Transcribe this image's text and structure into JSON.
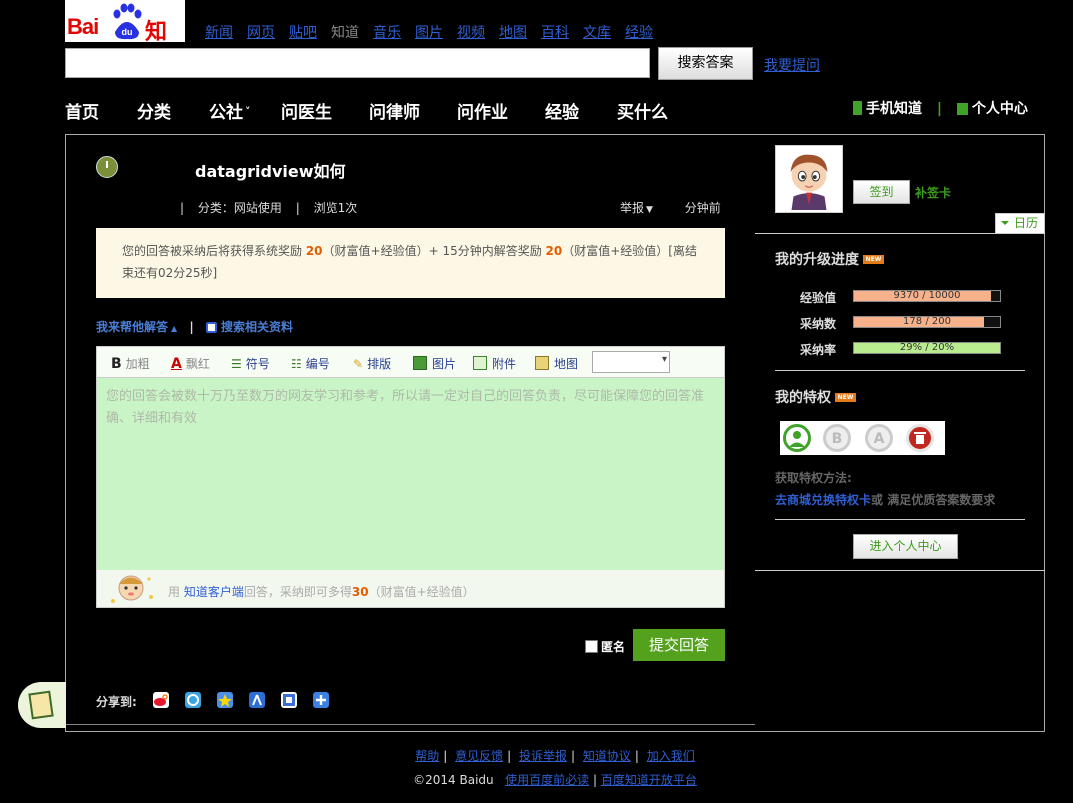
{
  "logo": {
    "text_left": "Bai",
    "text_paw": "du",
    "text_right": "知道"
  },
  "product_nav": [
    {
      "label": "新闻",
      "current": false
    },
    {
      "label": "网页",
      "current": false
    },
    {
      "label": "贴吧",
      "current": false
    },
    {
      "label": "知道",
      "current": true
    },
    {
      "label": "音乐",
      "current": false
    },
    {
      "label": "图片",
      "current": false
    },
    {
      "label": "视频",
      "current": false
    },
    {
      "label": "地图",
      "current": false
    },
    {
      "label": "百科",
      "current": false
    },
    {
      "label": "文库",
      "current": false
    },
    {
      "label": "经验",
      "current": false
    }
  ],
  "search": {
    "value": "",
    "button_label": "搜索答案",
    "ask_link": "我要提问"
  },
  "main_nav": [
    "首页",
    "分类",
    "公社",
    "问医生",
    "问律师",
    "问作业",
    "经验",
    "买什么"
  ],
  "main_nav_dropdown_icon": "chevron-down-icon",
  "right_nav": {
    "mobile": "手机知道",
    "personal": "个人中心",
    "sep": "|"
  },
  "question": {
    "title": "datagridview如何",
    "sep": "|",
    "category": "分类：网站使用",
    "views": "浏览1次",
    "report": "举报",
    "time": "分钟前"
  },
  "reward": {
    "t1": "您的回答被采纳后将获得系统奖励 ",
    "n1": "20",
    "t2": "（财富值+经验值）+ 15分钟内解答奖励 ",
    "n2": "20",
    "t3": "（财富值+经验值）[离结束还有02分25秒]"
  },
  "help": {
    "answer": "我来帮他解答",
    "sep": "|",
    "search_related": "搜索相关资料"
  },
  "toolbar": {
    "bold": "加粗",
    "red": "飘红",
    "symbol": "符号",
    "numbering": "编号",
    "format": "排版",
    "image": "图片",
    "attachment": "附件",
    "map": "地图",
    "select_value": ""
  },
  "editor": {
    "placeholder": "您的回答会被数十万乃至数万的网友学习和参考，所以请一定对自己的回答负责，尽可能保障您的回答准确、详细和有效",
    "client_prefix": "用",
    "client_link": "知道客户端",
    "client_mid": "回答，采纳即可多得",
    "client_num": "30",
    "client_suffix": "（财富值+经验值）"
  },
  "submit": {
    "anonymous": "匿名",
    "label": "提交回答"
  },
  "share": {
    "label": "分享到:"
  },
  "sidebar": {
    "sign_button": "签到",
    "make_up_card": "补签卡",
    "calendar": "日历",
    "progress_title": "我的升级进度",
    "new_tag": "NEW",
    "progress": [
      {
        "label": "经验值",
        "text": "9370 / 10000",
        "fraction": 0.937,
        "color": "#f7b28c"
      },
      {
        "label": "采纳数",
        "text": "178 / 200",
        "fraction": 0.89,
        "color": "#f7b28c"
      },
      {
        "label": "采纳率",
        "text": "29% / 20%",
        "fraction": 1.0,
        "color": "#b9ec8f"
      }
    ],
    "privilege_title": "我的特权",
    "privilege_icons": [
      "user-icon",
      "bold-b-icon",
      "font-a-icon",
      "trash-icon"
    ],
    "howto_label": "获取特权方法:",
    "howto_link": "去商城兑换特权卡",
    "howto_rest": "或 满足优质答案数要求",
    "enter_center": "进入个人中心"
  },
  "footer": {
    "links": [
      "帮助",
      "意见反馈",
      "投诉举报",
      "知道协议",
      "加入我们"
    ],
    "sep": "|",
    "copyright": "©2014 Baidu",
    "must_read": "使用百度前必读",
    "open_platform": "百度知道开放平台"
  }
}
